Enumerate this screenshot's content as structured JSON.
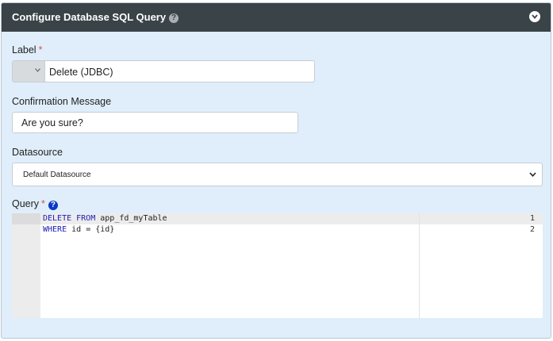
{
  "header": {
    "title": "Configure Database SQL Query",
    "help_glyph": "?"
  },
  "form": {
    "label": {
      "label": "Label",
      "required_mark": "*",
      "value": "Delete (JDBC)"
    },
    "confirmation": {
      "label": "Confirmation Message",
      "value": "Are you sure?"
    },
    "datasource": {
      "label": "Datasource",
      "selected": "Default Datasource"
    },
    "query": {
      "label": "Query",
      "required_mark": "*",
      "help_glyph": "?",
      "lines": [
        {
          "number": "1",
          "keyword": "DELETE FROM",
          "rest": " app_fd_myTable"
        },
        {
          "number": "2",
          "keyword": "WHERE",
          "rest": " id = {id}"
        }
      ]
    }
  },
  "colors": {
    "header_bg": "#3a4348",
    "panel_bg": "#dfeefa",
    "required": "#d9534f",
    "sql_keyword": "#1c1cb8",
    "help_icon": "#0a39c8"
  }
}
